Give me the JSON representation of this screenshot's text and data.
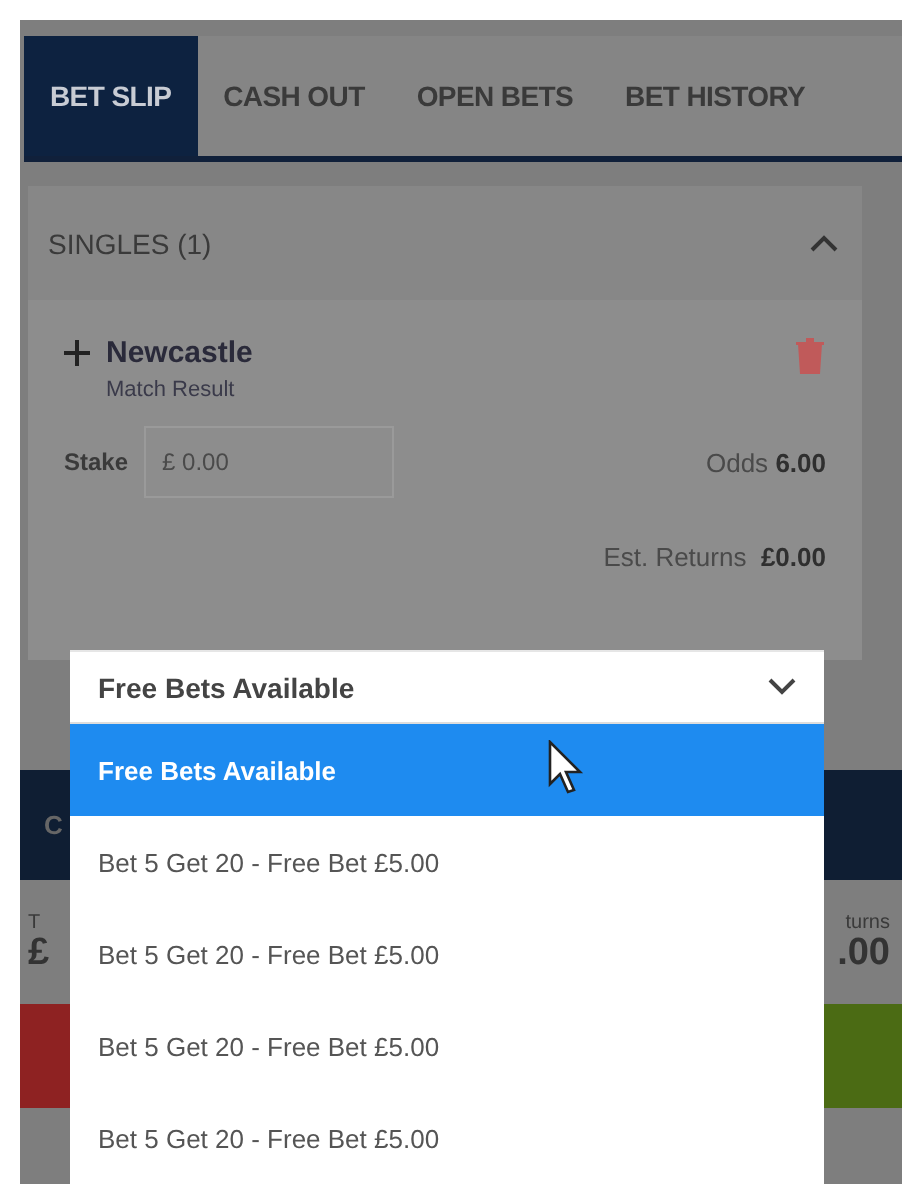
{
  "tabs": [
    {
      "label": "BET SLIP",
      "selected": true
    },
    {
      "label": "CASH OUT",
      "selected": false
    },
    {
      "label": "OPEN BETS",
      "selected": false
    },
    {
      "label": "BET HISTORY",
      "selected": false
    }
  ],
  "section": {
    "title": "SINGLES (1)",
    "expanded": true
  },
  "bet": {
    "selection": "Newcastle",
    "market": "Match Result",
    "stake_label": "Stake",
    "stake_placeholder": "£ 0.00",
    "odds_label": "Odds",
    "odds": "6.00",
    "returns_label": "Est. Returns",
    "returns": "£0.00"
  },
  "footer": {
    "bar_fragment": "C",
    "total_label_fragment": "T",
    "total_fragment": "£",
    "returns_label_fragment": "turns",
    "returns_fragment": ".00"
  },
  "free_bet_select": {
    "value": "Free Bets Available",
    "options": [
      {
        "label": "Free Bets Available",
        "selected": true
      },
      {
        "label": "Bet 5 Get 20 - Free Bet £5.00",
        "selected": false
      },
      {
        "label": "Bet 5 Get 20 - Free Bet £5.00",
        "selected": false
      },
      {
        "label": "Bet 5 Get 20 - Free Bet £5.00",
        "selected": false
      },
      {
        "label": "Bet 5 Get 20 - Free Bet £5.00",
        "selected": false
      }
    ]
  }
}
